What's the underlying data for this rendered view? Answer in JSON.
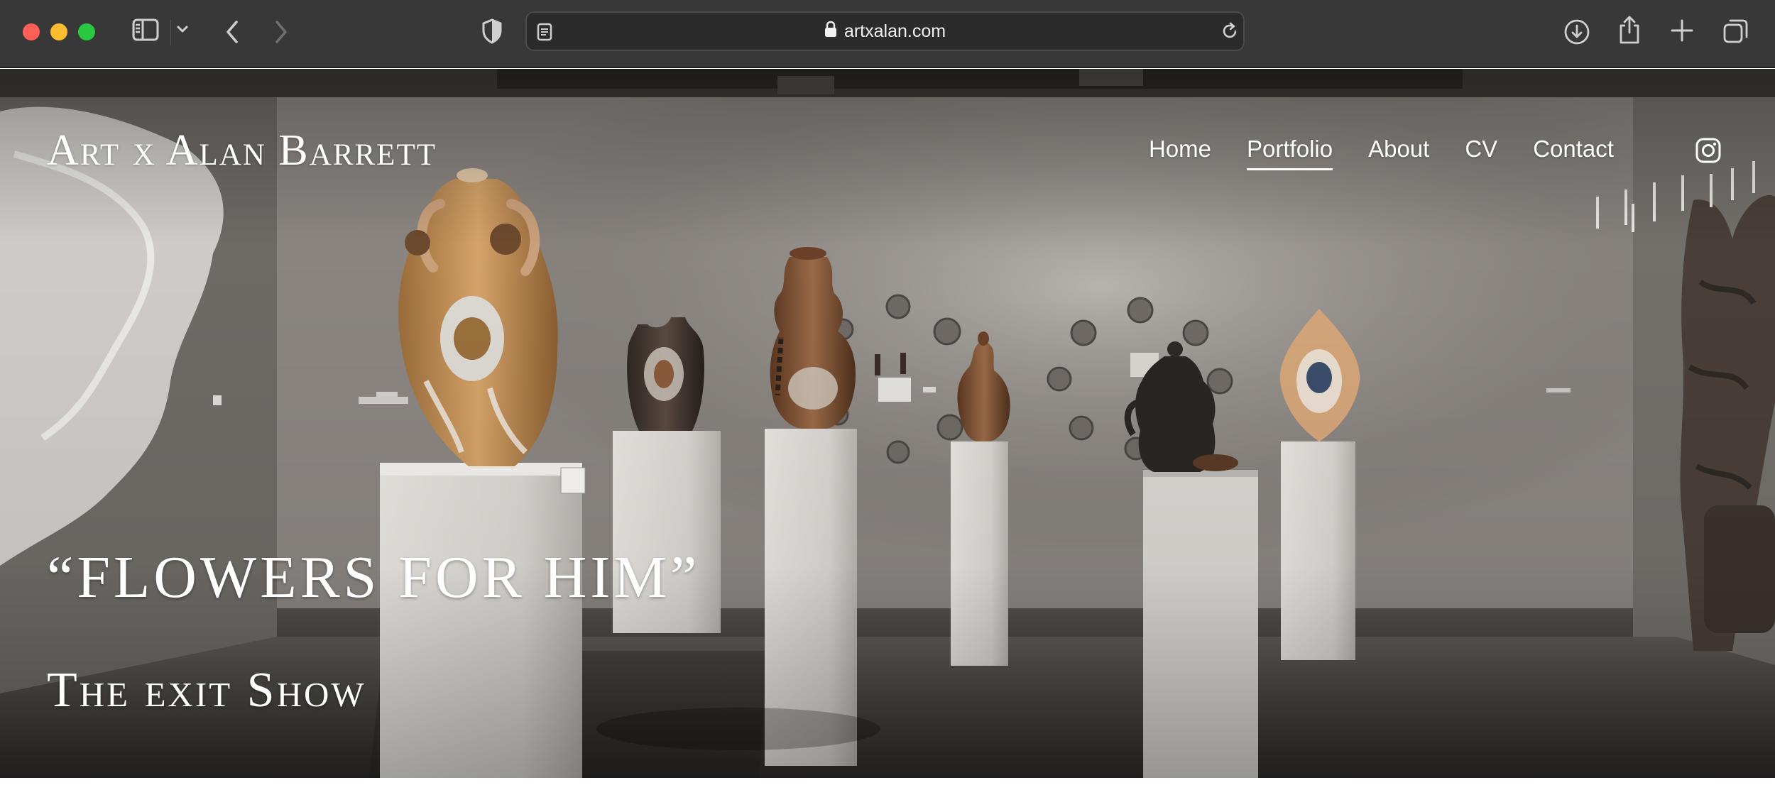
{
  "browser": {
    "url": "artxalan.com",
    "icons": {
      "sidebar": "sidebar-icon",
      "tab_menu": "chevron-down-icon",
      "back": "chevron-left-icon",
      "forward": "chevron-right-icon",
      "privacy": "shield-icon",
      "reader": "page-icon",
      "lock": "lock-icon",
      "reload": "reload-icon",
      "downloads": "download-icon",
      "share": "share-icon",
      "new_tab": "plus-icon",
      "tabs_overview": "tabs-icon"
    }
  },
  "site": {
    "title": "Art x Alan Barrett",
    "nav": [
      {
        "label": "Home",
        "active": false
      },
      {
        "label": "Portfolio",
        "active": true
      },
      {
        "label": "About",
        "active": false
      },
      {
        "label": "CV",
        "active": false
      },
      {
        "label": "Contact",
        "active": false
      }
    ],
    "social_icon": "instagram-icon"
  },
  "hero": {
    "heading": "“FLOWERS FOR HIM”",
    "subheading": "The exit Show",
    "image": "gallery-exhibition-photo"
  },
  "colors": {
    "chrome_bg": "#383838",
    "address_bg": "#2b2b2b",
    "hero_text": "#ffffff"
  }
}
